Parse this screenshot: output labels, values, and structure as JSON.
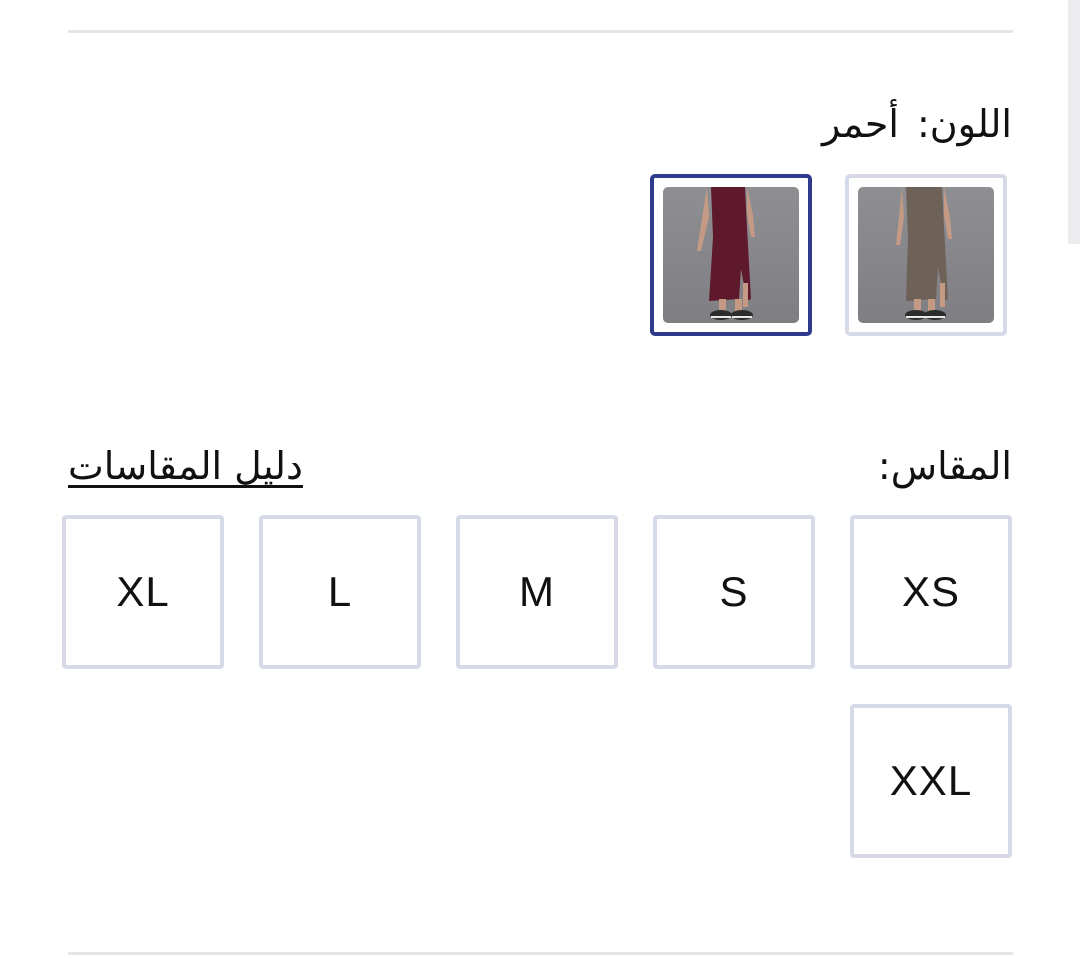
{
  "color": {
    "label": "اللون:",
    "value": "أحمر",
    "swatches": [
      {
        "name": "brown",
        "dress_color": "#6e6258",
        "selected": false
      },
      {
        "name": "red",
        "dress_color": "#5e1a2c",
        "selected": true
      }
    ]
  },
  "size": {
    "label": "المقاس:",
    "guide_link": "دليل المقاسات",
    "options": [
      "XS",
      "S",
      "M",
      "L",
      "XL",
      "XXL"
    ]
  },
  "colors": {
    "border_default": "#d6d9e8",
    "border_selected": "#2e3b8c",
    "divider": "#e6e6e9"
  }
}
